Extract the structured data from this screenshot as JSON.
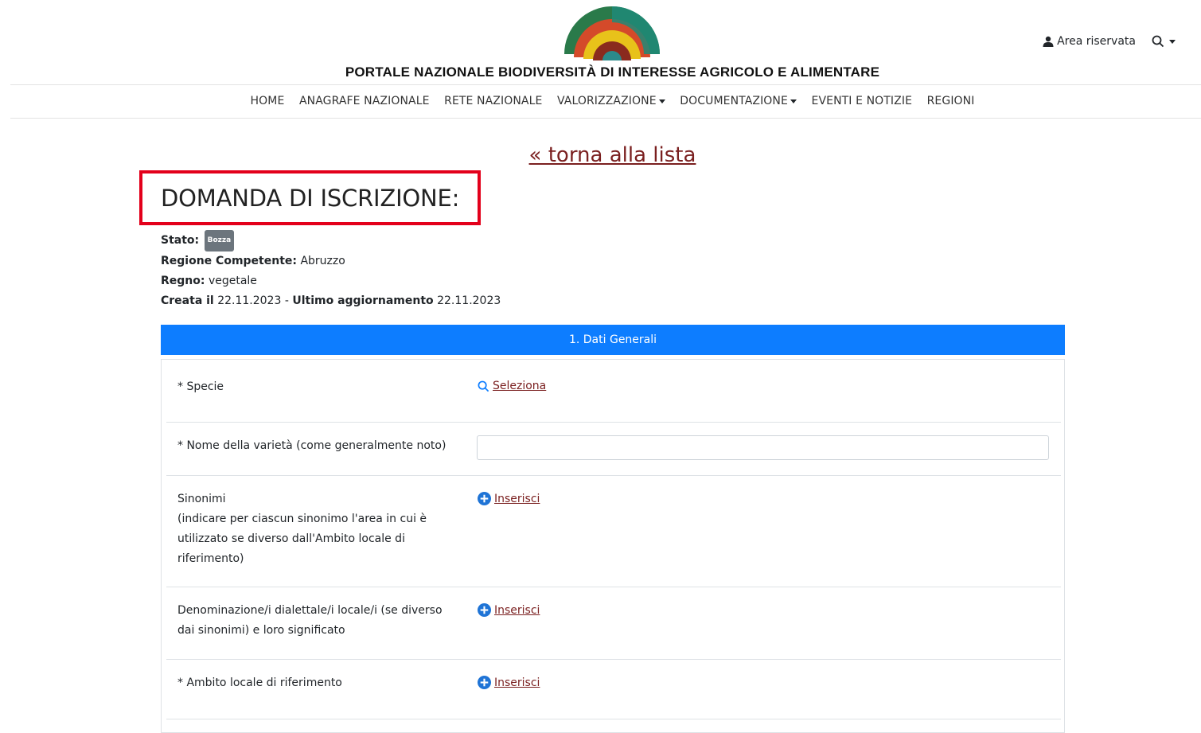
{
  "header": {
    "portal_title": "PORTALE NAZIONALE BIODIVERSITÀ DI INTERESSE AGRICOLO E ALIMENTARE",
    "area_riservata": "Area riservata"
  },
  "nav": {
    "items": [
      "HOME",
      "ANAGRAFE NAZIONALE",
      "RETE NAZIONALE",
      "VALORIZZAZIONE",
      "DOCUMENTAZIONE",
      "EVENTI E NOTIZIE",
      "REGIONI"
    ]
  },
  "back_link": "« torna alla lista",
  "page_title": "DOMANDA DI ISCRIZIONE:",
  "meta": {
    "stato_label": "Stato:",
    "stato_badge": "Bozza",
    "regione_label": "Regione Competente:",
    "regione_value": "Abruzzo",
    "regno_label": "Regno:",
    "regno_value": "vegetale",
    "creata_label": "Creata il",
    "creata_value": "22.11.2023",
    "separator": "-",
    "aggiornamento_label": "Ultimo aggiornamento",
    "aggiornamento_value": "22.11.2023"
  },
  "section": {
    "title": "1. Dati Generali"
  },
  "form": {
    "specie_label": "* Specie",
    "specie_action": "Seleziona",
    "nome_label": "* Nome della varietà (come generalmente noto)",
    "nome_value": "",
    "sinonimi_label": "Sinonimi",
    "sinonimi_note": "(indicare per ciascun sinonimo l'area in cui è utilizzato se diverso dall'Ambito locale di riferimento)",
    "sinonimi_action": "Inserisci",
    "denominazione_label": "Denominazione/i dialettale/i locale/i (se diverso dai sinonimi) e loro significato",
    "denominazione_action": "Inserisci",
    "ambito_label": "* Ambito locale di riferimento",
    "ambito_action": "Inserisci"
  },
  "colors": {
    "accent_blue": "#0d7dff",
    "link_maroon": "#7a1f1f",
    "highlight_red": "#e3001b",
    "badge_gray": "#6c757d"
  }
}
